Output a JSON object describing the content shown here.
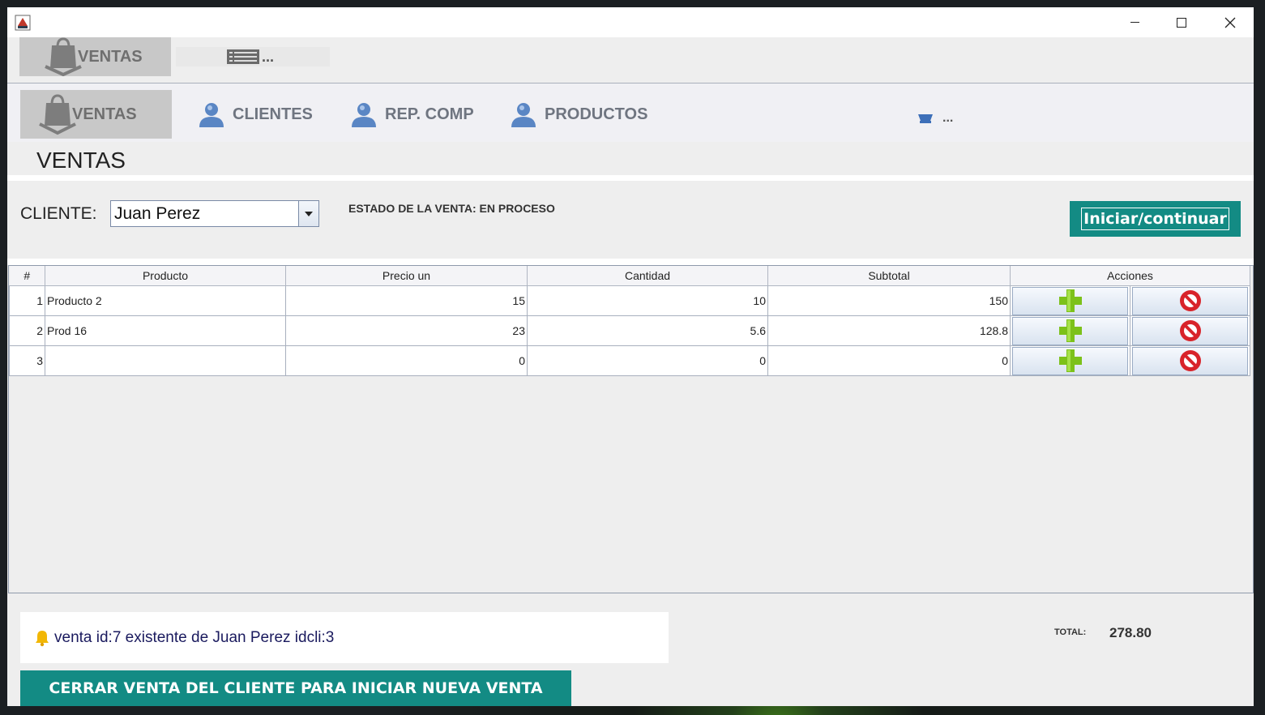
{
  "toolbar1": {
    "ventas_label": "VENTAS",
    "more_label": "..."
  },
  "nav": {
    "ventas": "VENTAS",
    "clientes": "CLIENTES",
    "rep_comp": "REP. COMP",
    "productos": "PRODUCTOS",
    "more": "..."
  },
  "page_title": "VENTAS",
  "form": {
    "cliente_label": "CLIENTE:",
    "cliente_value": "Juan Perez",
    "estado": "ESTADO DE LA VENTA:  EN PROCESO",
    "iniciar_button": "Iniciar/continuar"
  },
  "table": {
    "columns": [
      "#",
      "Producto",
      "Precio un",
      "Cantidad",
      "Subtotal",
      "Acciones"
    ],
    "rows": [
      {
        "idx": "1",
        "producto": "Producto 2",
        "precio": "15",
        "cantidad": "10",
        "subtotal": "150"
      },
      {
        "idx": "2",
        "producto": "Prod 16",
        "precio": "23",
        "cantidad": "5.6",
        "subtotal": "128.8"
      },
      {
        "idx": "3",
        "producto": "",
        "precio": "0",
        "cantidad": "0",
        "subtotal": "0"
      }
    ]
  },
  "footer": {
    "message": "venta id:7  existente de Juan Perez idcli:3",
    "total_label": "TOTAL:",
    "total_value": "278.80",
    "cerrar_button": "CERRAR VENTA DEL CLIENTE PARA INICIAR NUEVA VENTA"
  },
  "icons": {
    "bag": "shopping-bag-icon",
    "user": "user-icon",
    "list": "list-icon",
    "add": "plus-icon",
    "remove": "remove-icon",
    "bell": "bell-icon"
  },
  "colors": {
    "accent": "#138b84",
    "add_green": "#7cc11a",
    "remove_red": "#d8232a"
  }
}
